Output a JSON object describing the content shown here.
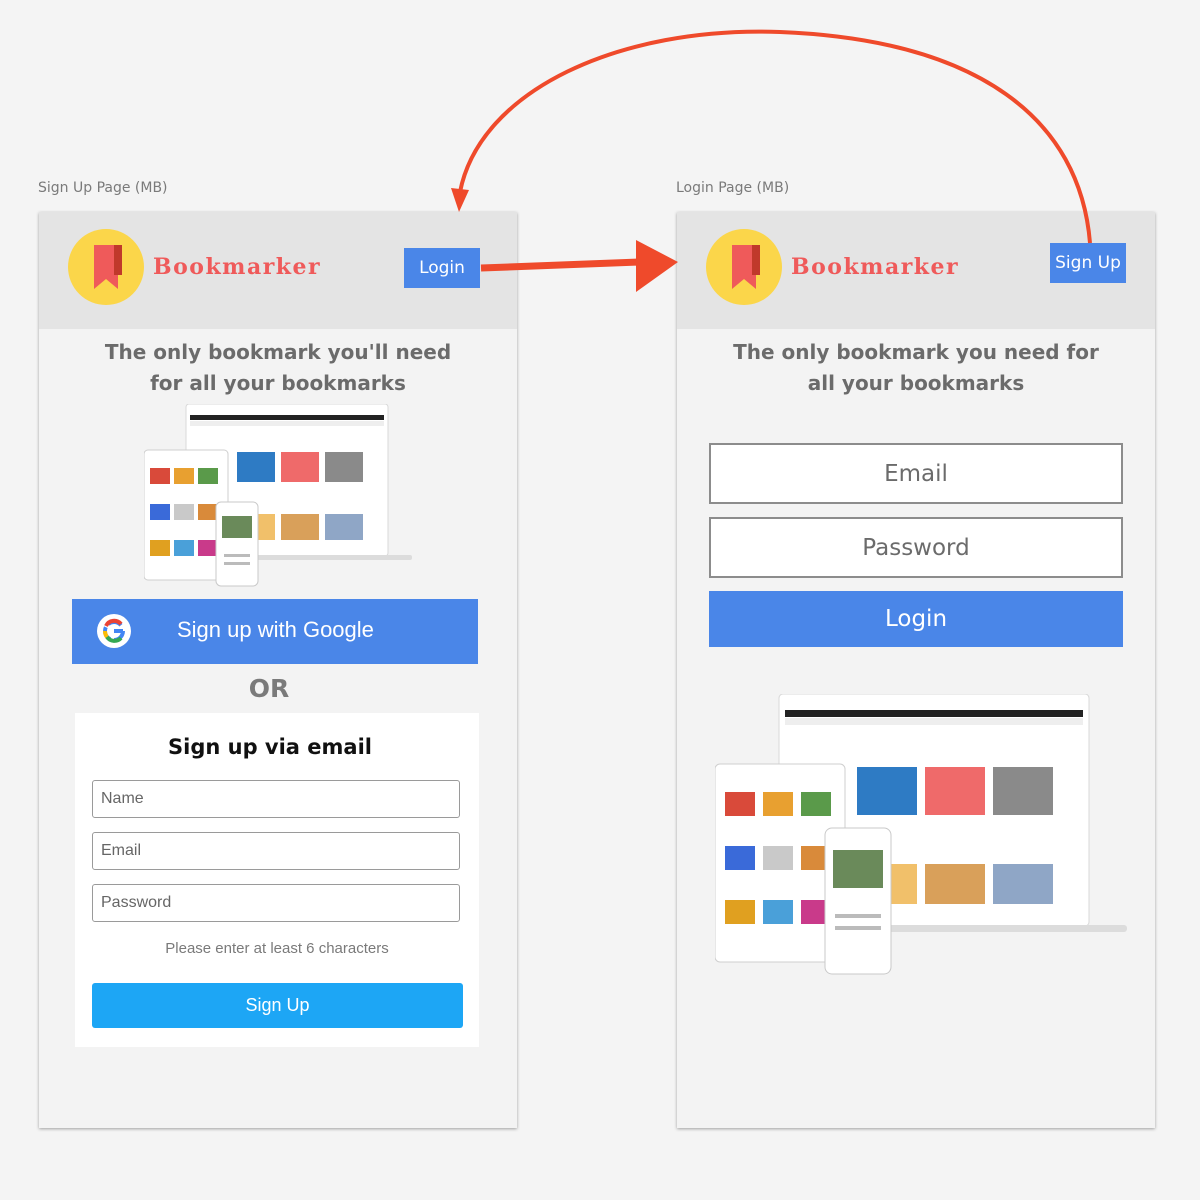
{
  "signup_frame": {
    "frame_label": "Sign Up Page (MB)",
    "brand": "Bookmarker",
    "login_button": "Login",
    "tagline_line1": "The only bookmark you'll need",
    "tagline_line2": "for all your bookmarks",
    "google_button": "Sign up with Google",
    "or_divider": "OR",
    "card_title": "Sign up via email",
    "name_placeholder": "Name",
    "email_placeholder": "Email",
    "password_placeholder": "Password",
    "password_hint": "Please enter at least 6 characters",
    "signup_button": "Sign Up"
  },
  "login_frame": {
    "frame_label": "Login Page (MB)",
    "brand": "Bookmarker",
    "signup_button": "Sign Up",
    "tagline_line1": "The only bookmark you need for",
    "tagline_line2": "all your bookmarks",
    "email_placeholder": "Email",
    "password_placeholder": "Password",
    "login_button": "Login"
  },
  "colors": {
    "accent_blue": "#4a86e8",
    "signup_blue": "#1da6f5",
    "brand_red": "#ef5a5a",
    "logo_yellow": "#fbd64a",
    "flow_arrow": "#ef4a2b"
  }
}
